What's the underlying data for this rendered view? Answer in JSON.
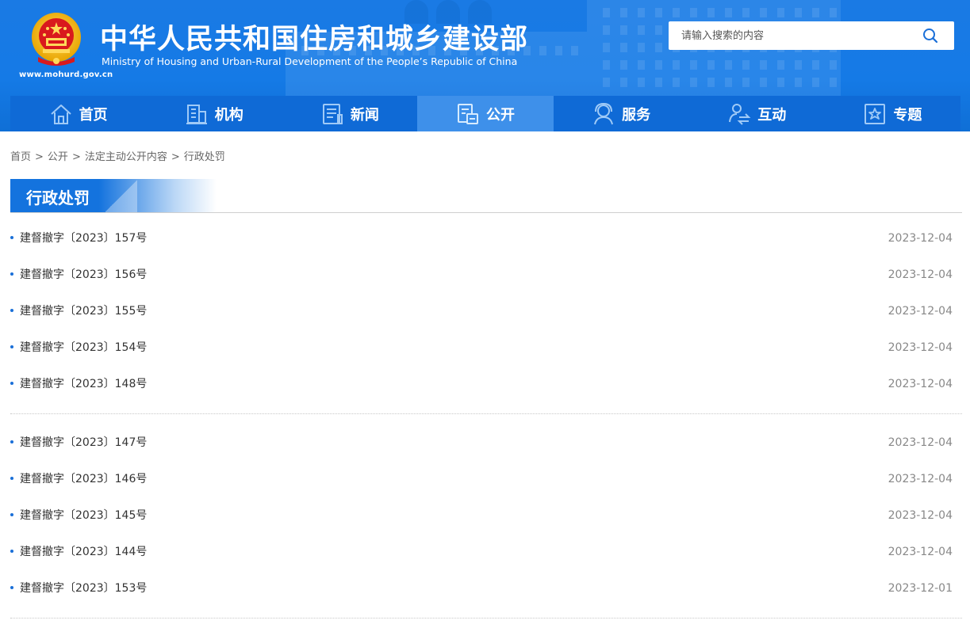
{
  "header": {
    "title_cn": "中华人民共和国住房和城乡建设部",
    "title_en": "Ministry of Housing and Urban-Rural Development of the People’s Republic of China",
    "site_url": "www.mohurd.gov.cn",
    "brand_color": "#157ae6"
  },
  "search": {
    "placeholder": "请输入搜索的内容",
    "value": ""
  },
  "nav": {
    "items": [
      {
        "label": "首页",
        "icon": "home-icon"
      },
      {
        "label": "机构",
        "icon": "building-icon"
      },
      {
        "label": "新闻",
        "icon": "news-icon"
      },
      {
        "label": "公开",
        "icon": "document-icon",
        "active": true
      },
      {
        "label": "服务",
        "icon": "service-icon"
      },
      {
        "label": "互动",
        "icon": "interaction-icon"
      },
      {
        "label": "专题",
        "icon": "star-frame-icon"
      }
    ],
    "active_color": "#3e90ea"
  },
  "breadcrumb": {
    "items": [
      "首页",
      "公开",
      "法定主动公开内容",
      "行政处罚"
    ],
    "separator": ">"
  },
  "section": {
    "title": "行政处罚"
  },
  "list_groups": [
    {
      "items": [
        {
          "title": "建督撤字〔2023〕157号",
          "date": "2023-12-04"
        },
        {
          "title": "建督撤字〔2023〕156号",
          "date": "2023-12-04"
        },
        {
          "title": "建督撤字〔2023〕155号",
          "date": "2023-12-04"
        },
        {
          "title": "建督撤字〔2023〕154号",
          "date": "2023-12-04"
        },
        {
          "title": "建督撤字〔2023〕148号",
          "date": "2023-12-04"
        }
      ]
    },
    {
      "items": [
        {
          "title": "建督撤字〔2023〕147号",
          "date": "2023-12-04"
        },
        {
          "title": "建督撤字〔2023〕146号",
          "date": "2023-12-04"
        },
        {
          "title": "建督撤字〔2023〕145号",
          "date": "2023-12-04"
        },
        {
          "title": "建督撤字〔2023〕144号",
          "date": "2023-12-04"
        },
        {
          "title": "建督撤字〔2023〕153号",
          "date": "2023-12-01"
        }
      ]
    }
  ]
}
